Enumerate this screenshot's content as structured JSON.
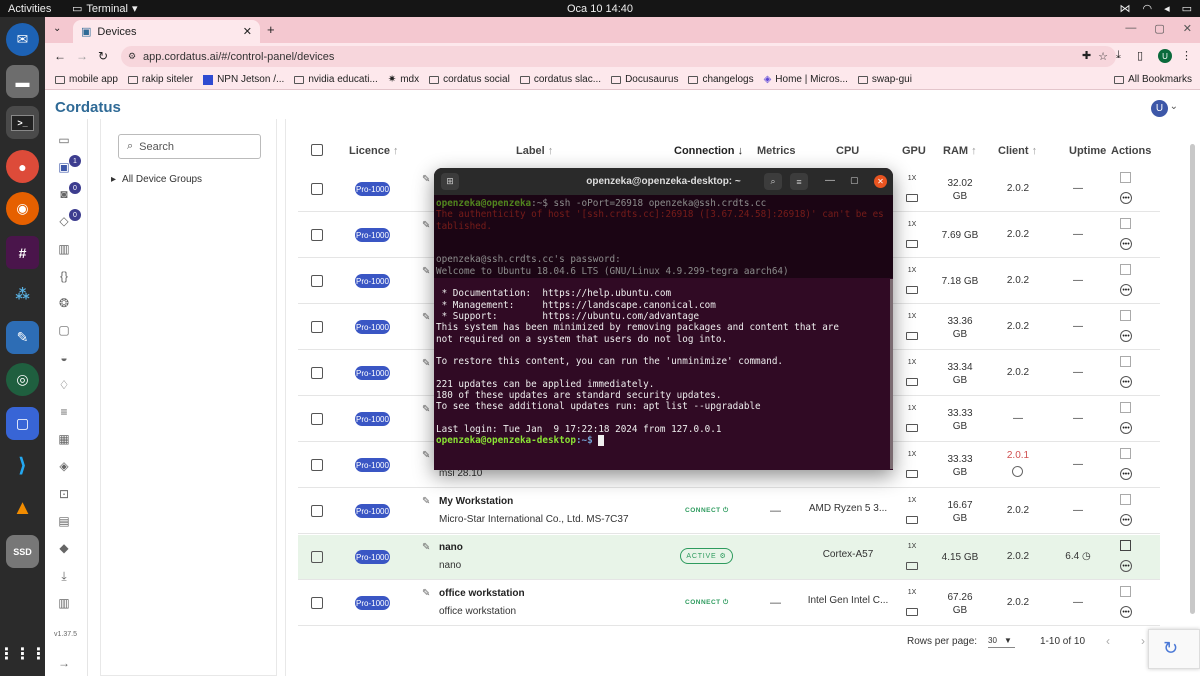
{
  "topbar": {
    "activities": "Activities",
    "app_name": "Terminal",
    "clock": "Oca 10  14:40"
  },
  "browser": {
    "tab_title": "Devices",
    "url": "app.cordatus.ai/#/control-panel/devices",
    "profile_initial": "U",
    "bookmarks": [
      "mobile app",
      "rakip siteler",
      "NPN Jetson /...",
      "nvidia educati...",
      "mdx",
      "cordatus social",
      "cordatus slac...",
      "Docusaurus",
      "changelogs",
      "Home | Micros...",
      "swap-gui"
    ],
    "all_bookmarks": "All Bookmarks"
  },
  "app": {
    "logo": "Cordatus",
    "user_initial": "U",
    "version": "v1.37.5",
    "nav_badges": [
      "1",
      "0",
      "0"
    ]
  },
  "groups": {
    "search_placeholder": "Search",
    "all_groups": "All Device Groups"
  },
  "table": {
    "headers": {
      "licence": "Licence",
      "label": "Label",
      "connection": "Connection",
      "metrics": "Metrics",
      "cpu": "CPU",
      "gpu": "GPU",
      "ram": "RAM",
      "client": "Client",
      "uptime": "Uptime",
      "actions": "Actions"
    },
    "sort_up": "↑",
    "sort_down": "↓",
    "rows": [
      {
        "licence": "Pro-1000",
        "gpu": "1X",
        "ram1": "32.02",
        "ram2": "GB",
        "client": "2.0.2",
        "uptime": "—"
      },
      {
        "licence": "Pro-1000",
        "gpu": "1X",
        "ram1": "7.69 GB",
        "ram2": "",
        "client": "2.0.2",
        "uptime": "—"
      },
      {
        "licence": "Pro-1000",
        "gpu": "1X",
        "ram1": "7.18 GB",
        "ram2": "",
        "client": "2.0.2",
        "uptime": "—"
      },
      {
        "licence": "Pro-1000",
        "gpu": "1X",
        "ram1": "33.36",
        "ram2": "GB",
        "client": "2.0.2",
        "uptime": "—"
      },
      {
        "licence": "Pro-1000",
        "gpu": "1X",
        "ram1": "33.34",
        "ram2": "GB",
        "client": "2.0.2",
        "uptime": "—"
      },
      {
        "licence": "Pro-1000",
        "gpu": "1X",
        "ram1": "33.33",
        "ram2": "GB",
        "client": "—",
        "uptime": "—"
      },
      {
        "licence": "Pro-1000",
        "sub": "msi 28.10",
        "gpu": "1X",
        "ram1": "33.33",
        "ram2": "GB",
        "client": "2.0.1",
        "uptime": "—"
      },
      {
        "licence": "Pro-1000",
        "label": "My Workstation",
        "sub": "Micro-Star International Co., Ltd. MS-7C37",
        "connection": "CONNECT",
        "metrics": "—",
        "cpu": "AMD Ryzen 5 3...",
        "gpu": "1X",
        "ram1": "16.67",
        "ram2": "GB",
        "client": "2.0.2",
        "uptime": "—"
      },
      {
        "licence": "Pro-1000",
        "label": "nano",
        "sub": "nano",
        "connection": "ACTIVE",
        "cpu": "Cortex-A57",
        "gpu": "1X",
        "ram1": "4.15 GB",
        "ram2": "",
        "client": "2.0.2",
        "uptime": "6.4"
      },
      {
        "licence": "Pro-1000",
        "label": "office workstation",
        "sub": "office workstation",
        "connection": "CONNECT",
        "metrics": "—",
        "cpu": "Intel Gen Intel C...",
        "gpu": "1X",
        "ram1": "67.26",
        "ram2": "GB",
        "client": "2.0.2",
        "uptime": "—"
      }
    ]
  },
  "pager": {
    "rows_per_page_label": "Rows per page:",
    "rows_per_page_value": "30",
    "range": "1-10 of 10"
  },
  "terminal": {
    "title": "openzeka@openzeka-desktop: ~",
    "lines": {
      "l1_prompt": "openzeka@openzeka",
      "l1_cmd": ":~$ ssh -oPort=26918 openzeka@ssh.crdts.cc",
      "l2": "The authenticity of host '[ssh.crdts.cc]:26918 ([3.67.24.58]:26918)' can't be es",
      "l3": "tablished.",
      "l4": "password:",
      "pw": "openzeka@ssh.crdts.cc's password:",
      "welcome": "Welcome to Ubuntu 18.04.6 LTS (GNU/Linux 4.9.299-tegra aarch64)",
      "doc": " * Documentation:  https://help.ubuntu.com",
      "mgmt": " * Management:     https://landscape.canonical.com",
      "support": " * Support:        https://ubuntu.com/advantage",
      "min1": "This system has been minimized by removing packages and content that are",
      "min2": "not required on a system that users do not log into.",
      "restore": "To restore this content, you can run the 'unminimize' command.",
      "upd1": "221 updates can be applied immediately.",
      "upd2": "180 of these updates are standard security updates.",
      "upd3": "To see these additional updates run: apt list --upgradable",
      "last": "Last login: Tue Jan  9 17:22:18 2024 from 127.0.0.1",
      "prompt_user": "openzeka@openzeka-desktop",
      "prompt_tail": ":~$ "
    }
  }
}
